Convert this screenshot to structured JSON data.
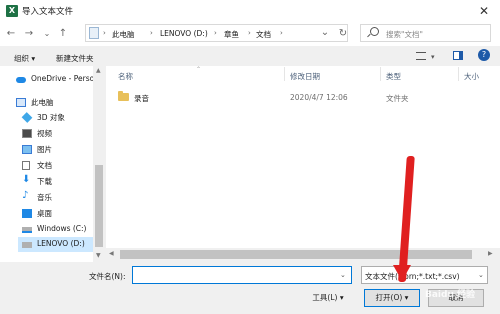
{
  "window": {
    "title": "导入文本文件",
    "close_glyph": "✕",
    "app_icon_letter": "X"
  },
  "nav": {
    "back": "←",
    "forward": "→",
    "recent": "⌄",
    "up": "↑",
    "refresh": "↻"
  },
  "breadcrumbs": [
    "此电脑",
    "LENOVO (D:)",
    "章鱼",
    "文档"
  ],
  "search": {
    "placeholder": "搜索\"文档\""
  },
  "toolbar": {
    "organize": "组织 ▾",
    "new_folder": "新建文件夹"
  },
  "sidebar": {
    "items": [
      {
        "label": "OneDrive - Perso",
        "icon": "cloud-icon"
      },
      {
        "label": "此电脑",
        "icon": "computer-icon"
      },
      {
        "label": "3D 对象",
        "icon": "cube-icon"
      },
      {
        "label": "视频",
        "icon": "video-icon"
      },
      {
        "label": "图片",
        "icon": "picture-icon"
      },
      {
        "label": "文档",
        "icon": "document-icon"
      },
      {
        "label": "下载",
        "icon": "download-icon"
      },
      {
        "label": "音乐",
        "icon": "music-icon"
      },
      {
        "label": "桌面",
        "icon": "desktop-icon"
      },
      {
        "label": "Windows (C:)",
        "icon": "drive-icon"
      },
      {
        "label": "LENOVO (D:)",
        "icon": "drive-icon"
      }
    ]
  },
  "columns": {
    "name": "名称",
    "modified": "修改日期",
    "type": "类型",
    "size": "大小"
  },
  "files": [
    {
      "name": "录音",
      "modified": "2020/4/7 12:06",
      "type": "文件夹",
      "size": ""
    }
  ],
  "bottom": {
    "filename_label": "文件名(N):",
    "filename_value": "",
    "filetype_value": "文本文件(*.prn;*.txt;*.csv)",
    "tools": "工具(L) ▾",
    "open": "打开(O) ▾",
    "cancel": "取消"
  },
  "watermark": "Baidu 经验",
  "colors": {
    "accent": "#0078d7",
    "annotation_arrow": "#e02020",
    "excel_green": "#1e7145"
  }
}
